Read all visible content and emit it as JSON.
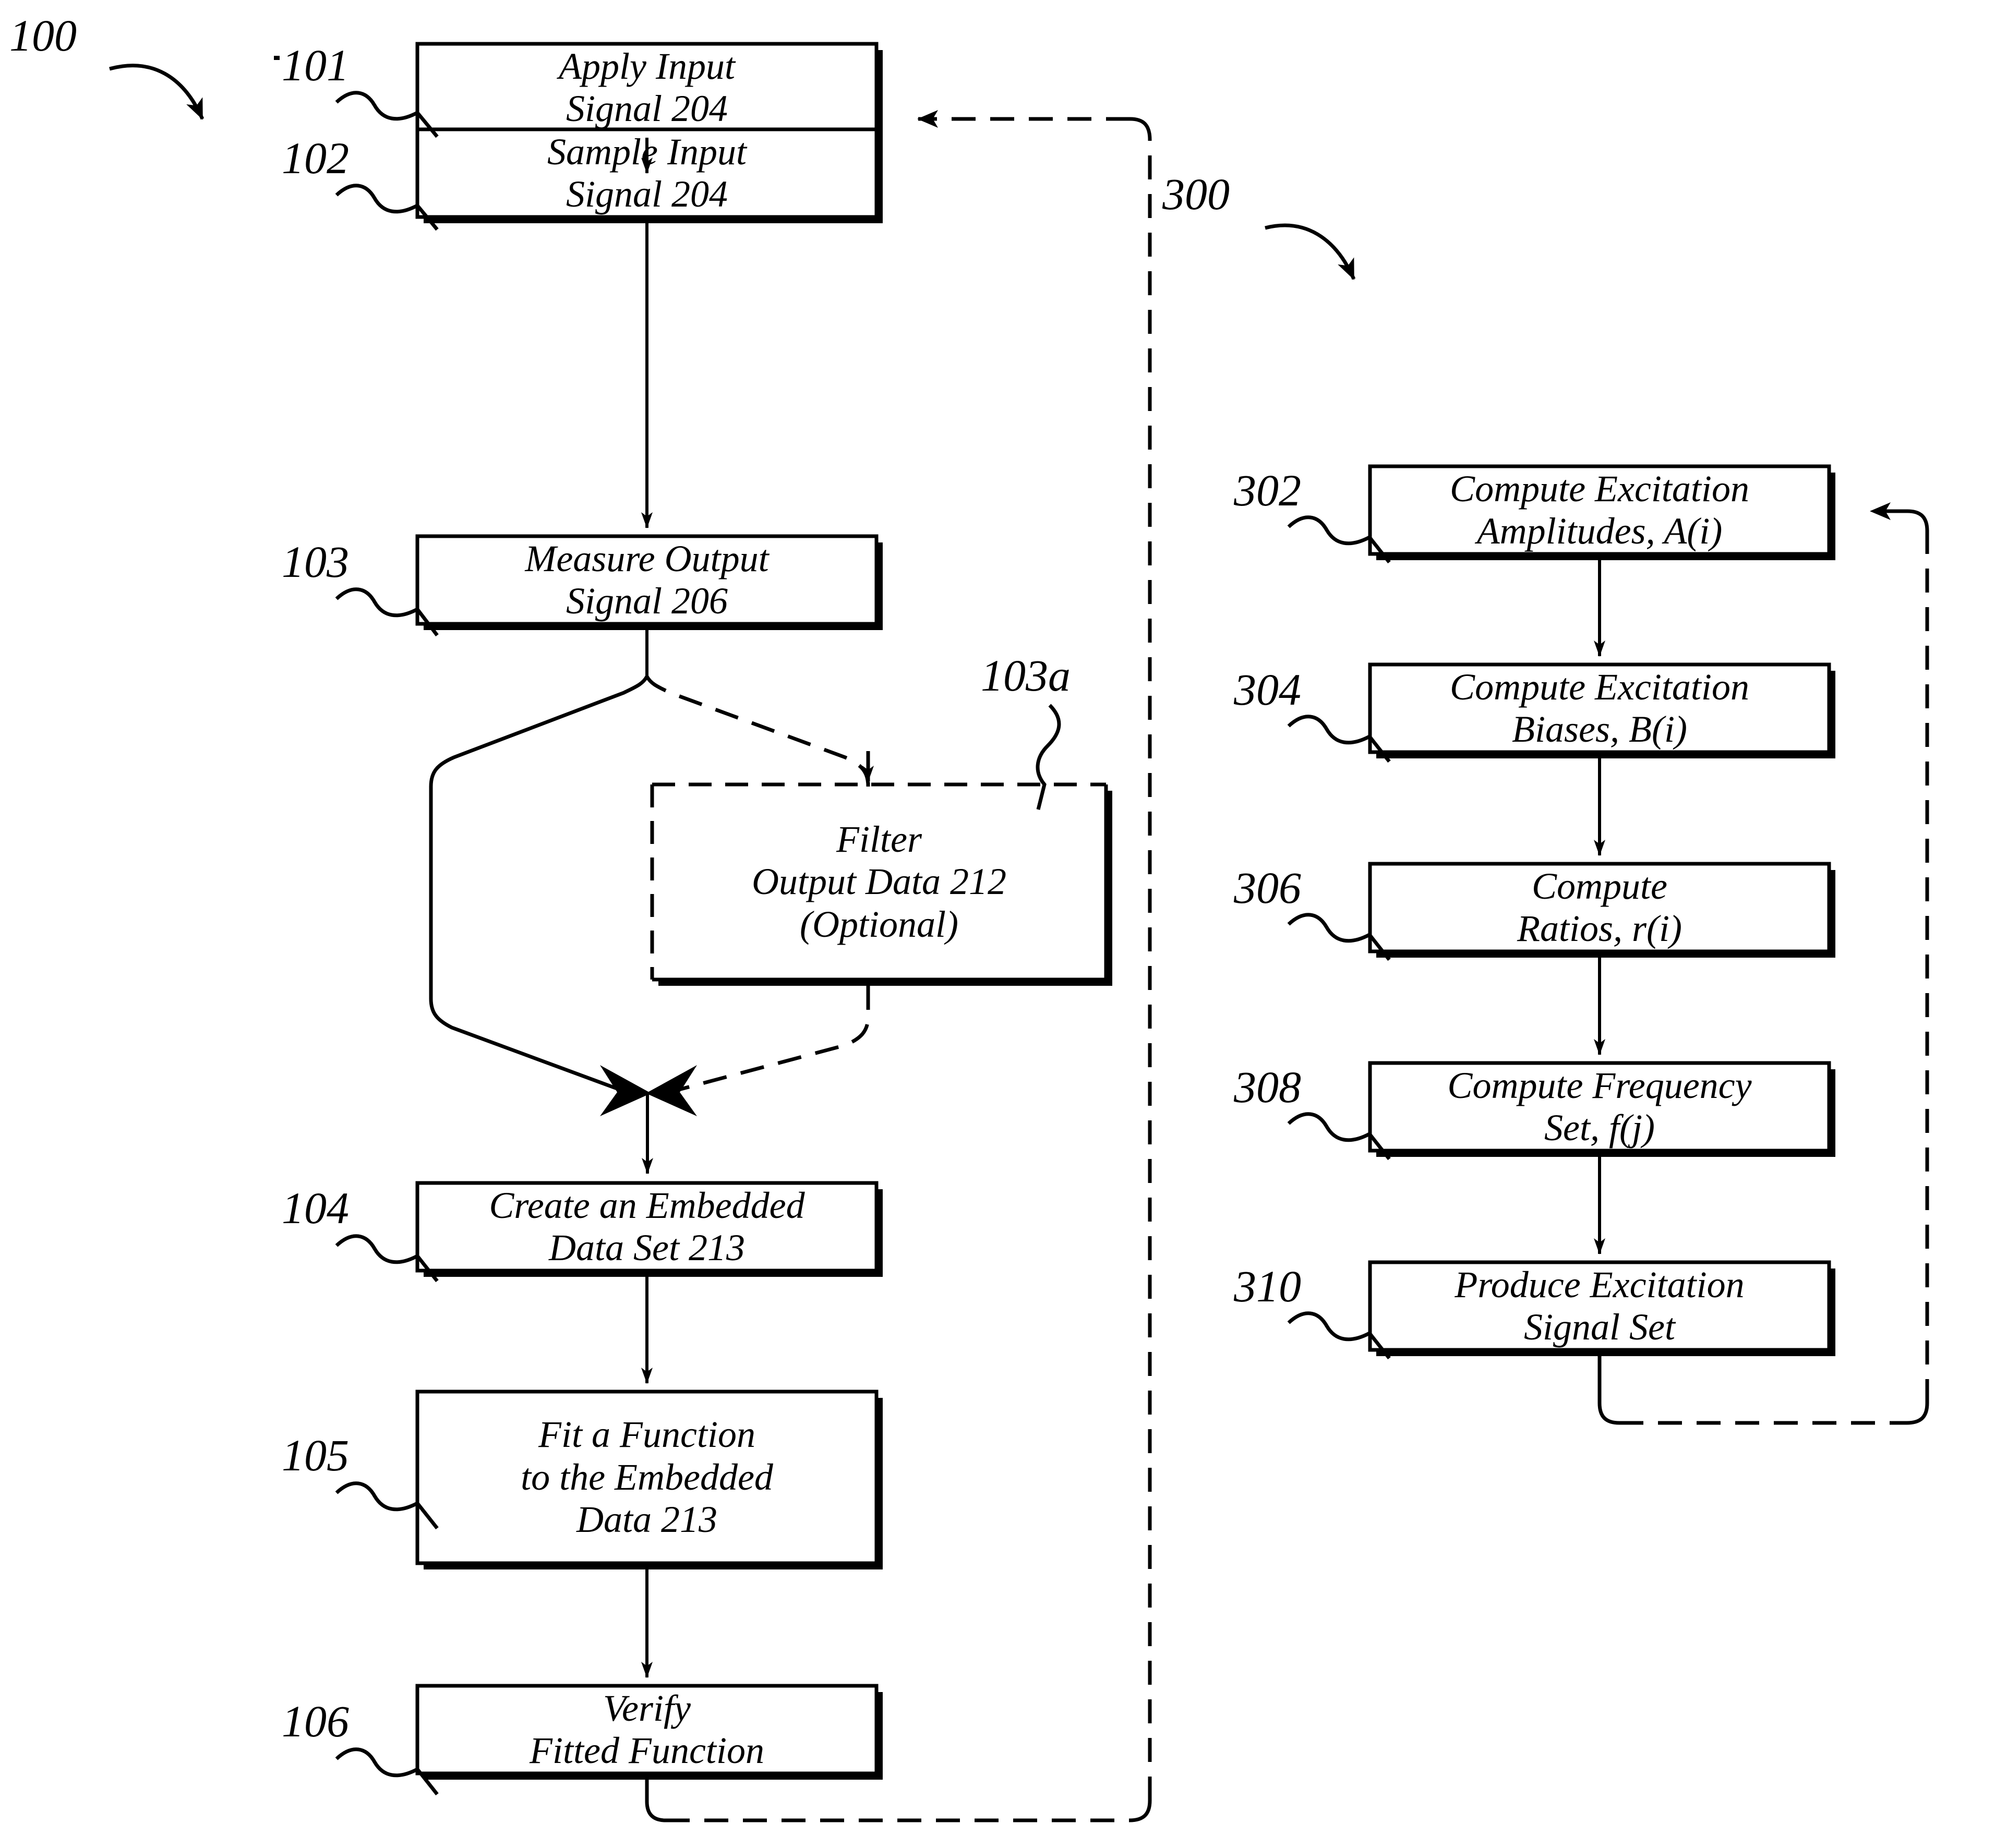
{
  "figure": {
    "type": "patent-flowchart",
    "background_color": "#ffffff",
    "line_color": "#000000"
  },
  "diagrams": [
    {
      "id": "100",
      "ref_label": "100",
      "title_arrow": "curved-arrow-pointing-down-right"
    },
    {
      "id": "300",
      "ref_label": "300",
      "title_arrow": "curved-arrow-pointing-down-right"
    }
  ],
  "left_flow": {
    "ref_100": "100",
    "steps": [
      {
        "ref": "101",
        "lines": [
          "Apply Input",
          "Signal 204"
        ],
        "optional": false
      },
      {
        "ref": "102",
        "lines": [
          "Sample Input",
          "Signal 204"
        ],
        "optional": false
      },
      {
        "ref": "103",
        "lines": [
          "Measure Output",
          "Signal 206"
        ],
        "optional": false
      },
      {
        "ref": "103a",
        "lines": [
          "Filter",
          "Output Data 212",
          "(Optional)"
        ],
        "optional": true
      },
      {
        "ref": "104",
        "lines": [
          "Create an Embedded",
          "Data Set 213"
        ],
        "optional": false
      },
      {
        "ref": "105",
        "lines": [
          "Fit a Function",
          "to the Embedded",
          "Data 213"
        ],
        "optional": false
      },
      {
        "ref": "106",
        "lines": [
          "Verify",
          "Fitted Function"
        ],
        "optional": false
      }
    ]
  },
  "right_flow": {
    "ref_300": "300",
    "steps": [
      {
        "ref": "302",
        "lines": [
          "Compute Excitation",
          "Amplitudes, A(i)"
        ]
      },
      {
        "ref": "304",
        "lines": [
          "Compute Excitation",
          "Biases, B(i)"
        ]
      },
      {
        "ref": "306",
        "lines": [
          "Compute",
          "Ratios, r(i)"
        ]
      },
      {
        "ref": "308",
        "lines": [
          "Compute Frequency",
          "Set, f(j)"
        ]
      },
      {
        "ref": "310",
        "lines": [
          "Produce Excitation",
          "Signal Set"
        ]
      }
    ]
  },
  "connections": [
    {
      "name": "arrow-101-to-102",
      "style": "solid",
      "from": "101",
      "to": "102"
    },
    {
      "name": "arrow-102-to-103",
      "style": "solid",
      "from": "102",
      "to": "103"
    },
    {
      "name": "branch-103-bypass",
      "style": "solid",
      "from": "103",
      "to": "merge"
    },
    {
      "name": "branch-103-to-filter",
      "style": "dashed",
      "from": "103",
      "to": "103a"
    },
    {
      "name": "arrow-filter-to-merge",
      "style": "dashed",
      "from": "103a",
      "to": "merge"
    },
    {
      "name": "arrow-merge-to-104",
      "style": "solid",
      "from": "merge",
      "to": "104"
    },
    {
      "name": "arrow-104-to-105",
      "style": "solid",
      "from": "104",
      "to": "105"
    },
    {
      "name": "arrow-105-to-106",
      "style": "solid",
      "from": "105",
      "to": "106"
    },
    {
      "name": "feedback-106-to-101",
      "style": "dashed",
      "from": "106",
      "to": "101"
    },
    {
      "name": "arrow-302-to-304",
      "style": "solid",
      "from": "302",
      "to": "304"
    },
    {
      "name": "arrow-304-to-306",
      "style": "solid",
      "from": "304",
      "to": "306"
    },
    {
      "name": "arrow-306-to-308",
      "style": "solid",
      "from": "306",
      "to": "308"
    },
    {
      "name": "arrow-308-to-310",
      "style": "solid",
      "from": "308",
      "to": "310"
    },
    {
      "name": "feedback-310-to-302",
      "style": "dashed",
      "from": "310",
      "to": "302"
    }
  ]
}
